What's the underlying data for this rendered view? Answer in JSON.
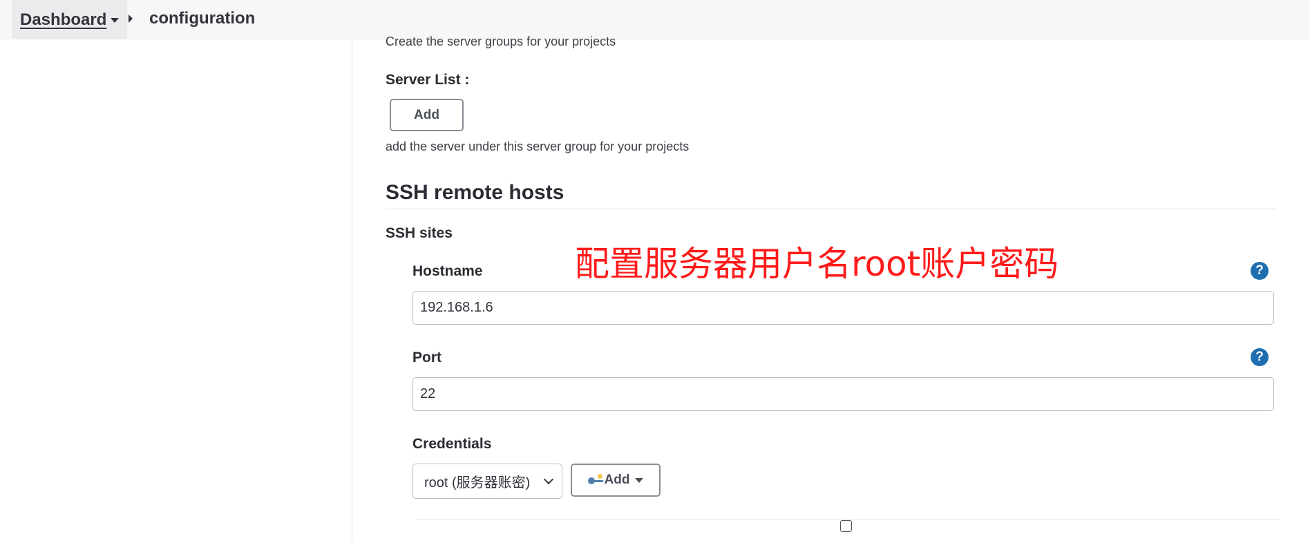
{
  "breadcrumb": {
    "dashboard_label": "Dashboard",
    "current_label": "configuration"
  },
  "server_groups": {
    "helper_top": "Create the server groups for your projects",
    "server_list_label": "Server List :",
    "add_button_label": "Add",
    "helper_bottom": "add the server under this server group for your projects"
  },
  "ssh_section": {
    "title": "SSH remote hosts",
    "sites_label": "SSH sites"
  },
  "annotation_text": "配置服务器用户名root账户密码",
  "hostname": {
    "label": "Hostname",
    "value": "192.168.1.6",
    "help_glyph": "?"
  },
  "port": {
    "label": "Port",
    "value": "22",
    "help_glyph": "?"
  },
  "credentials": {
    "label": "Credentials",
    "selected": "root (服务器账密)",
    "add_button_label": "Add"
  },
  "colors": {
    "annotation": "#ff1a1a",
    "help_icon": "#1f6fb0",
    "topbar_bg": "#f7f7f8"
  },
  "icons": {
    "breadcrumb_caret": "caret-down-icon",
    "breadcrumb_separator": "chevron-right-icon",
    "help": "question-circle-icon",
    "credentials_add": "key-icon",
    "select": "chevron-down-icon"
  }
}
